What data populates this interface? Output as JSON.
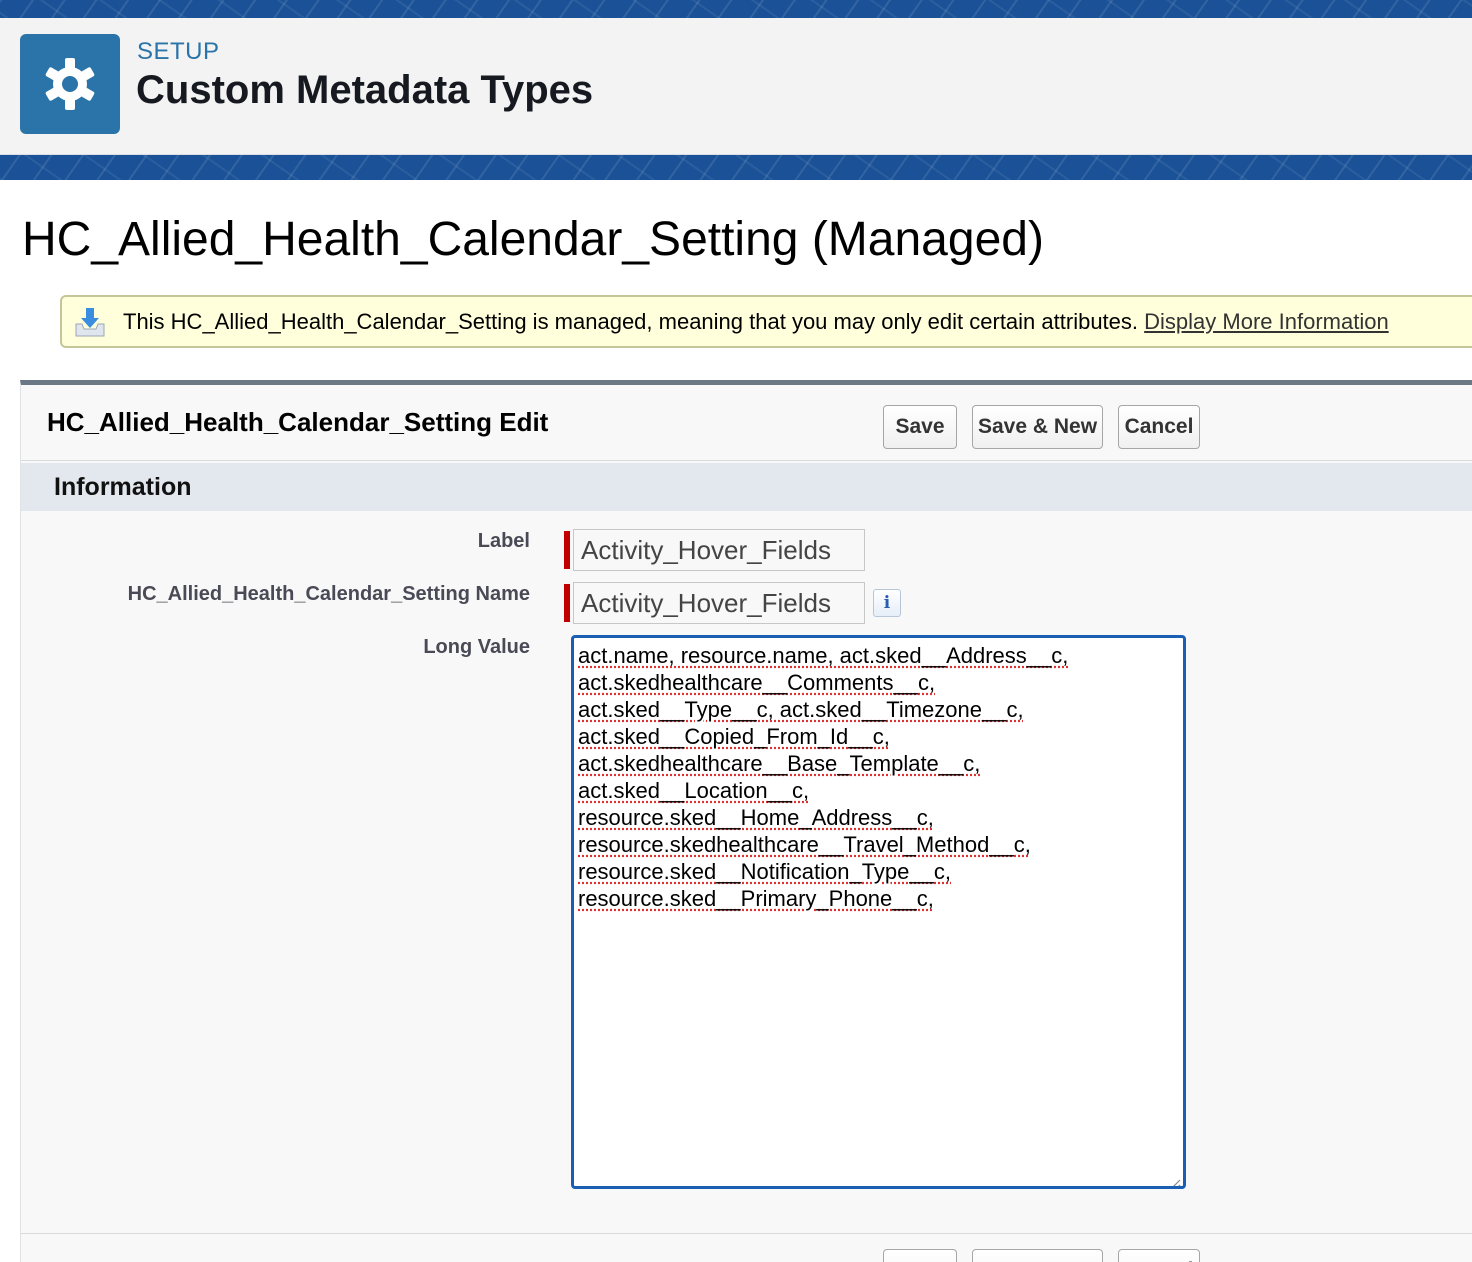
{
  "header": {
    "eyebrow": "SETUP",
    "title": "Custom Metadata Types",
    "icon": "gear-icon"
  },
  "page": {
    "title": "HC_Allied_Health_Calendar_Setting (Managed)"
  },
  "banner": {
    "icon": "download-tray-icon",
    "text": "This HC_Allied_Health_Calendar_Setting is managed, meaning that you may only edit certain attributes.",
    "link": "Display More Information"
  },
  "panel": {
    "title": "HC_Allied_Health_Calendar_Setting Edit",
    "buttons": {
      "save": "Save",
      "save_new": "Save & New",
      "cancel": "Cancel"
    },
    "section_title": "Information"
  },
  "fields": {
    "label": {
      "label": "Label",
      "value": "Activity_Hover_Fields"
    },
    "name": {
      "label": "HC_Allied_Health_Calendar_Setting Name",
      "value": "Activity_Hover_Fields",
      "info_glyph": "i"
    },
    "long_value": {
      "label": "Long Value",
      "lines": [
        "act.name, resource.name, act.sked__Address__c,",
        "act.skedhealthcare__Comments__c,",
        "act.sked__Type__c, act.sked__Timezone__c,",
        "act.sked__Copied_From_Id__c,",
        "act.skedhealthcare__Base_Template__c,",
        "act.sked__Location__c,",
        "resource.sked__Home_Address__c,",
        "resource.skedhealthcare__Travel_Method__c,",
        "resource.sked__Notification_Type__c,",
        "resource.sked__Primary_Phone__c,"
      ]
    }
  },
  "colors": {
    "brand_blue": "#2a74a9",
    "focus_border": "#1b5fb5",
    "required_marker": "#c00000",
    "banner_bg": "#ffffdc"
  }
}
